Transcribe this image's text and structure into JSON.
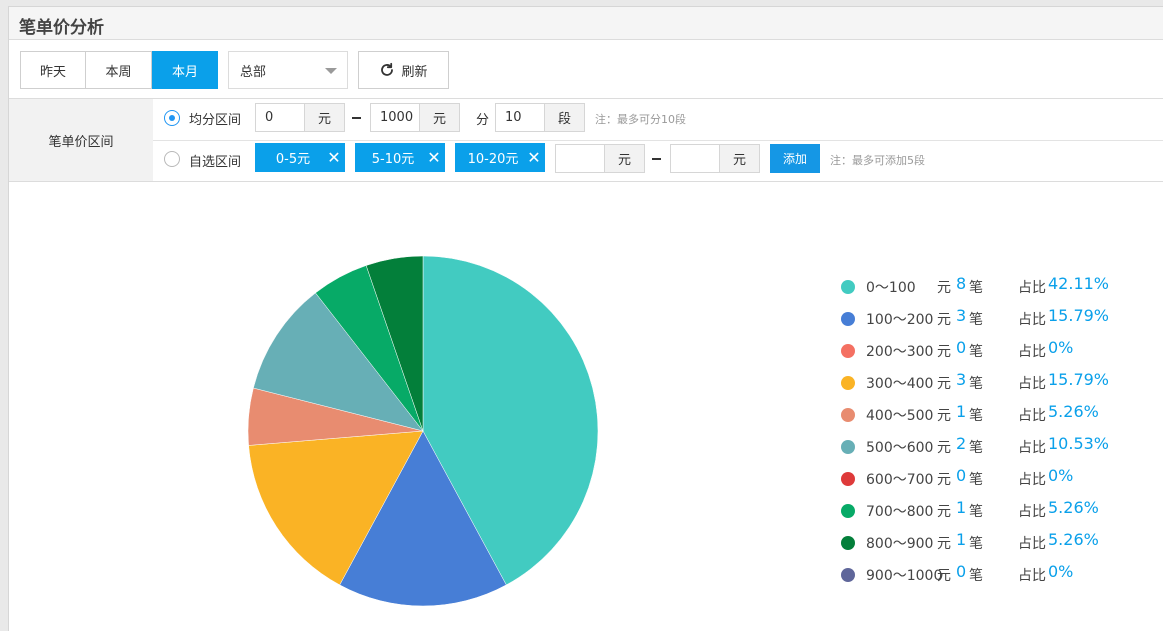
{
  "page": {
    "title": "笔单价分析"
  },
  "toolbar": {
    "periods": [
      "昨天",
      "本周",
      "本月"
    ],
    "active_period": "本月",
    "store_select": "总部",
    "refresh_label": "刷新"
  },
  "filter": {
    "section_label": "笔单价区间",
    "mode_even_label": "均分区间",
    "mode_custom_label": "自选区间",
    "selected_mode": "均分区间",
    "even": {
      "min_value": "0",
      "min_unit": "元",
      "max_value": "1000",
      "max_unit": "元",
      "split_label": "分",
      "segments_value": "10",
      "segments_unit": "段",
      "note": "注：最多可分10段"
    },
    "custom": {
      "tags": [
        "0-5元",
        "5-10元",
        "10-20元"
      ],
      "from_value": "",
      "from_unit": "元",
      "to_value": "",
      "to_unit": "元",
      "add_label": "添加",
      "note": "注：最多可添加5段"
    }
  },
  "chart_data": {
    "type": "pie",
    "title": "",
    "slices": [
      {
        "range": "0～100",
        "count": 8,
        "percent": 42.11,
        "color": "#42cbc1"
      },
      {
        "range": "100～200",
        "count": 3,
        "percent": 15.79,
        "color": "#477ed6"
      },
      {
        "range": "200～300",
        "count": 0,
        "percent": 0,
        "color": "#f47062"
      },
      {
        "range": "300～400",
        "count": 3,
        "percent": 15.79,
        "color": "#fab325"
      },
      {
        "range": "400～500",
        "count": 1,
        "percent": 5.26,
        "color": "#e88c70"
      },
      {
        "range": "500～600",
        "count": 2,
        "percent": 10.53,
        "color": "#67afb6"
      },
      {
        "range": "600～700",
        "count": 0,
        "percent": 0,
        "color": "#de3a3a"
      },
      {
        "range": "700～800",
        "count": 1,
        "percent": 5.26,
        "color": "#07aa67"
      },
      {
        "range": "800～900",
        "count": 1,
        "percent": 5.26,
        "color": "#037f3a"
      },
      {
        "range": "900～1000",
        "count": 0,
        "percent": 0,
        "color": "#5f669a"
      }
    ],
    "unit_label": "元",
    "count_suffix": "笔",
    "percent_label": "占比",
    "legend_position": "right"
  }
}
